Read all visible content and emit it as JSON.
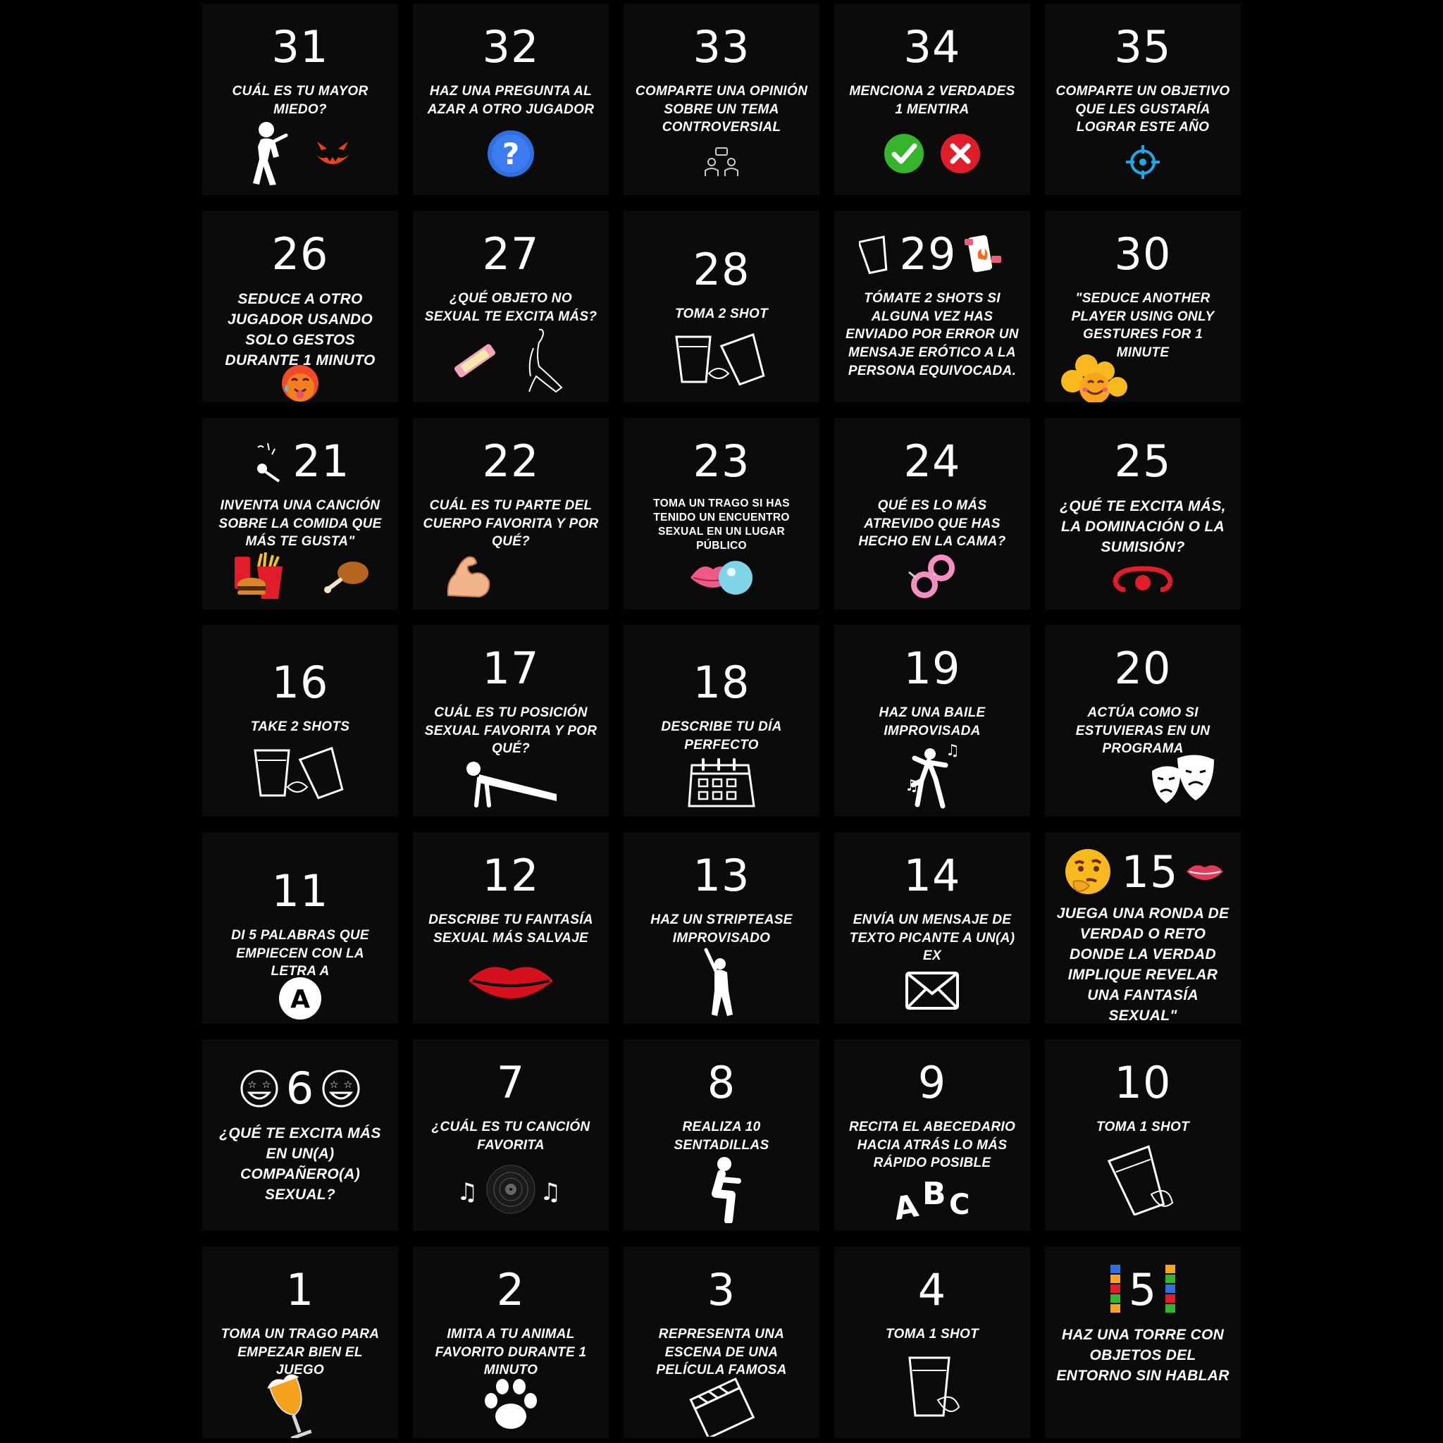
{
  "board": {
    "rows": [
      [
        {
          "number": "31",
          "text": "CUÁL ES TU MAYOR MIEDO?",
          "icons": [
            "scared-person-icon",
            "pumpkin-face-icon"
          ]
        },
        {
          "number": "32",
          "text": "HAZ UNA PREGUNTA AL AZAR A OTRO JUGADOR",
          "icons": [
            "question-circle-icon"
          ]
        },
        {
          "number": "33",
          "text": "COMPARTE UNA OPINIÓN SOBRE UN TEMA CONTROVERSIAL",
          "icons": [
            "discussion-icon"
          ]
        },
        {
          "number": "34",
          "text": "MENCIONA 2 VERDADES 1 MENTIRA",
          "icons": [
            "check-circle-icon",
            "cross-circle-icon"
          ]
        },
        {
          "number": "35",
          "text": "COMPARTE UN OBJETIVO QUE LES GUSTARÍA LOGRAR ESTE AÑO",
          "icons": [
            "target-icon"
          ]
        }
      ],
      [
        {
          "number": "26",
          "text": "SEDUCE A OTRO JUGADOR USANDO SOLO GESTOS DURANTE 1 MINUTO",
          "icons": [
            "hot-face-icon"
          ]
        },
        {
          "number": "27",
          "text": "¿QUÉ OBJETO NO SEXUAL TE EXCITA MÁS?",
          "icons": [
            "candy-bar-icon",
            "silhouette-icon"
          ]
        },
        {
          "number": "28",
          "text": "TOMA 2 SHOT",
          "icons": [
            "shot-glasses-icon"
          ]
        },
        {
          "number": "29",
          "text": "TÓMATE 2 SHOTS SI ALGUNA VEZ HAS ENVIADO POR ERROR UN MENSAJE ERÓTICO A LA PERSONA EQUIVOCADA.",
          "icons": [
            "shot-glass-icon",
            "phone-hearts-icon"
          ]
        },
        {
          "number": "30",
          "text": "\"SEDUCE ANOTHER PLAYER USING ONLY GESTURES FOR 1 MINUTE",
          "icons": [
            "emoji-pile-icon"
          ]
        }
      ],
      [
        {
          "number": "21",
          "text": "INVENTA UNA CANCIÓN SOBRE LA COMIDA QUE MÁS TE GUSTA\"",
          "icons": [
            "microphone-icon",
            "fast-food-icon",
            "chicken-leg-icon"
          ]
        },
        {
          "number": "22",
          "text": "CUÁL ES TU PARTE DEL CUERPO FAVORITA Y POR QUÉ?",
          "icons": [
            "flexed-arm-icon"
          ]
        },
        {
          "number": "23",
          "text": "TOMA UN TRAGO SI HAS TENIDO UN ENCUENTRO SEXUAL EN UN LUGAR PÚBLICO",
          "icons": [
            "lips-bubble-icon"
          ]
        },
        {
          "number": "24",
          "text": "QUÉ ES LO MÁS ATREVIDO QUE HAS HECHO EN LA CAMA?",
          "icons": [
            "handcuffs-icon"
          ]
        },
        {
          "number": "25",
          "text": "¿QUÉ TE EXCITA MÁS, LA DOMINACIÓN O LA SUMISIÓN?",
          "icons": [
            "ball-gag-icon"
          ]
        }
      ],
      [
        {
          "number": "16",
          "text": "TAKE 2 SHOTS",
          "icons": [
            "shot-glasses-icon"
          ]
        },
        {
          "number": "17",
          "text": "CUÁL ES TU POSICIÓN SEXUAL FAVORITA Y POR QUÉ?",
          "icons": [
            "pushup-icon"
          ]
        },
        {
          "number": "18",
          "text": "DESCRIBE TU DÍA PERFECTO",
          "icons": [
            "calendar-icon"
          ]
        },
        {
          "number": "19",
          "text": "HAZ UNA BAILE IMPROVISADA",
          "icons": [
            "dancer-icon"
          ]
        },
        {
          "number": "20",
          "text": "ACTÚA COMO SI ESTUVIERAS EN UN PROGRAMA",
          "icons": [
            "theater-masks-icon"
          ]
        }
      ],
      [
        {
          "number": "11",
          "text": "DI 5 PALABRAS QUE EMPIECEN CON LA LETRA A",
          "icons": [
            "letter-a-icon"
          ]
        },
        {
          "number": "12",
          "text": "DESCRIBE TU FANTASÍA SEXUAL MÁS SALVAJE",
          "icons": [
            "red-lips-icon"
          ]
        },
        {
          "number": "13",
          "text": "HAZ UN STRIPTEASE IMPROVISADO",
          "icons": [
            "dancer-silhouette-icon"
          ]
        },
        {
          "number": "14",
          "text": "ENVÍA UN MENSAJE DE TEXTO PICANTE A UN(A) EX",
          "icons": [
            "envelope-icon"
          ]
        },
        {
          "number": "15",
          "text": "JUEGA UNA RONDA DE VERDAD O RETO DONDE LA VERDAD IMPLIQUE REVELAR UNA FANTASÍA SEXUAL\"",
          "icons": [
            "thinking-face-icon",
            "kiss-lips-icon"
          ]
        }
      ],
      [
        {
          "number": "6",
          "text": "¿QUÉ TE EXCITA MÁS EN UN(A) COMPAÑERO(A) SEXUAL?",
          "icons": [
            "star-eyes-face-icon",
            "star-eyes-face-icon"
          ]
        },
        {
          "number": "7",
          "text": "¿CUÁL ES TU CANCIÓN FAVORITA",
          "icons": [
            "music-notes-icon",
            "vinyl-record-icon",
            "music-notes-icon"
          ]
        },
        {
          "number": "8",
          "text": "REALIZA 10 SENTADILLAS",
          "icons": [
            "squat-icon"
          ]
        },
        {
          "number": "9",
          "text": "RECITA EL ABECEDARIO HACIA ATRÁS LO MÁS RÁPIDO POSIBLE",
          "icons": [
            "abc-letters-icon"
          ]
        },
        {
          "number": "10",
          "text": "TOMA 1 SHOT",
          "icons": [
            "shot-glass-icon"
          ]
        }
      ],
      [
        {
          "number": "1",
          "text": "TOMA UN TRAGO PARA EMPEZAR BIEN EL JUEGO",
          "icons": [
            "beer-glass-icon"
          ]
        },
        {
          "number": "2",
          "text": "IMITA A TU ANIMAL FAVORITO DURANTE 1 MINUTO",
          "icons": [
            "paw-icon"
          ]
        },
        {
          "number": "3",
          "text": "REPRESENTA UNA ESCENA DE UNA PELÍCULA FAMOSA",
          "icons": [
            "clapperboard-icon"
          ]
        },
        {
          "number": "4",
          "text": "TOMA 1 SHOT",
          "icons": [
            "shot-glass-icon"
          ]
        },
        {
          "number": "5",
          "text": "HAZ UNA TORRE CON OBJETOS DEL ENTORNO SIN HABLAR",
          "icons": [
            "block-tower-icon"
          ]
        }
      ]
    ]
  },
  "colors": {
    "background": "#000000",
    "tile": "#0b0b0b",
    "text": "#ffffff",
    "accent_red": "#e11d2a",
    "accent_blue": "#2f6fe0",
    "accent_green": "#35b52c"
  }
}
